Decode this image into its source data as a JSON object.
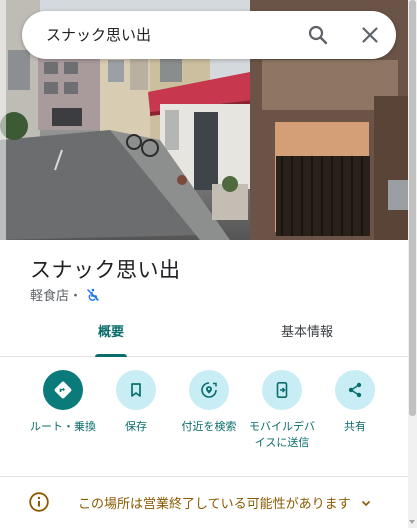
{
  "search": {
    "query": "スナック思い出",
    "search_icon": "search-icon",
    "close_icon": "close-icon"
  },
  "place": {
    "name": "スナック思い出",
    "category": "軽食店・",
    "accessibility_icon": "wheelchair-not-accessible-icon"
  },
  "tabs": [
    {
      "label": "概要",
      "active": true
    },
    {
      "label": "基本情報",
      "active": false
    }
  ],
  "actions": [
    {
      "label": "ルート・乗換",
      "icon": "directions-icon",
      "primary": true
    },
    {
      "label": "保存",
      "icon": "bookmark-icon",
      "primary": false
    },
    {
      "label": "付近を検索",
      "icon": "nearby-icon",
      "primary": false
    },
    {
      "label": "モバイルデバイスに送信",
      "icon": "send-to-phone-icon",
      "primary": false
    },
    {
      "label": "共有",
      "icon": "share-icon",
      "primary": false
    }
  ],
  "notice": {
    "text": "この場所は営業終了している可能性があります",
    "icon": "info-icon",
    "expand_icon": "chevron-down-icon"
  },
  "colors": {
    "accent": "#0b6d6b",
    "primary_button": "#0b7a7a",
    "secondary_button": "#c8edf5",
    "notice_text": "#8a5a00"
  }
}
